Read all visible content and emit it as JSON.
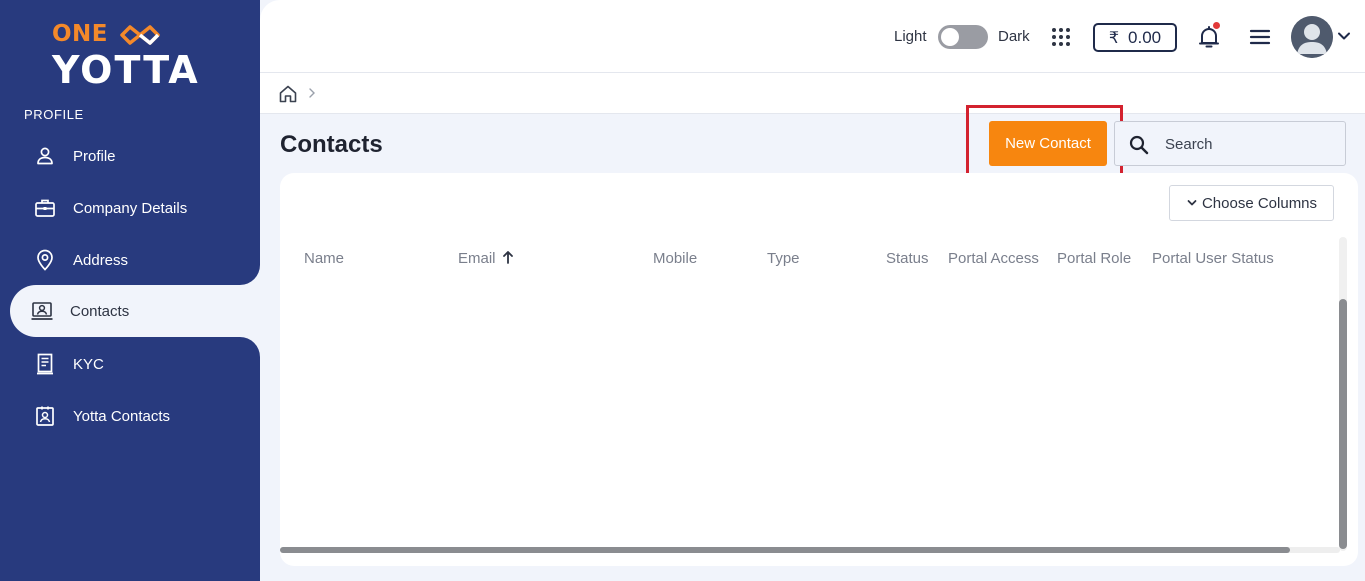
{
  "brand": {
    "one": "ONE",
    "yotta": "YOTTA",
    "orange": "#f4892a"
  },
  "sidebar": {
    "section_label": "PROFILE",
    "items": [
      {
        "label": "Profile",
        "icon": "person-icon"
      },
      {
        "label": "Company Details",
        "icon": "briefcase-icon"
      },
      {
        "label": "Address",
        "icon": "location-pin-icon"
      },
      {
        "label": "Contacts",
        "icon": "contact-card-icon",
        "active": true
      },
      {
        "label": "KYC",
        "icon": "document-icon"
      },
      {
        "label": "Yotta Contacts",
        "icon": "contact-badge-icon"
      }
    ],
    "bg_color": "#283a7e"
  },
  "topbar": {
    "theme_light": "Light",
    "theme_dark": "Dark",
    "dark_mode": false,
    "wallet_symbol": "₹",
    "wallet_balance": "0.00"
  },
  "page": {
    "title": "Contacts",
    "new_contact_label": "New Contact",
    "search_placeholder": "Search",
    "search_value": "",
    "choose_columns_label": "Choose Columns",
    "accent_color": "#f7860f",
    "highlight_color": "#d3222f"
  },
  "table": {
    "columns": [
      "Name",
      "Email",
      "Mobile",
      "Type",
      "Status",
      "Portal Access",
      "Portal Role",
      "Portal User Status"
    ],
    "sorted_column": "Email",
    "sort_direction": "ascending",
    "rows": []
  }
}
